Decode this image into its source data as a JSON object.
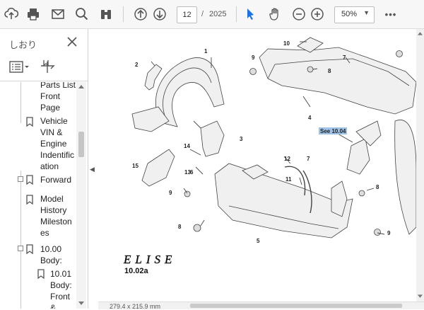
{
  "toolbar": {
    "tools": [
      "upload-icon",
      "print-icon",
      "mail-icon",
      "search-icon",
      "binoculars-icon",
      "page-up-icon",
      "page-down-icon",
      "select-cursor-icon",
      "hand-icon",
      "zoom-out-icon",
      "zoom-in-icon",
      "more-icon"
    ],
    "page_current": "12",
    "page_separator": "/",
    "page_total": "2025",
    "zoom": "50%",
    "zoom_caret": "▼",
    "more": "•••"
  },
  "sidebar": {
    "title": "しおり",
    "close": "✕",
    "bookmarks": [
      {
        "label": "Parts List Front Page",
        "level": 1
      },
      {
        "label": "Vehicle VIN & Engine Indentification",
        "level": 1
      },
      {
        "label": "Forward",
        "level": 1
      },
      {
        "label": "Model History Milestones",
        "level": 1
      },
      {
        "label": "10.00 Body:",
        "level": 1
      },
      {
        "label": "10.01 Body: Front &",
        "level": 2
      }
    ],
    "bookmark_lines": [
      [
        "Parts List",
        "Front",
        "Page"
      ],
      [
        "Vehicle",
        "VIN &",
        "Engine",
        "Indentific",
        "ation"
      ],
      [
        "Forward"
      ],
      [
        "Model",
        "History",
        "Mileston",
        "es"
      ],
      [
        "10.00",
        "Body:"
      ],
      [
        "10.01",
        "Body:",
        "Front",
        "&"
      ]
    ]
  },
  "document": {
    "page_size": "279.4 x 215.9 mm",
    "logo": "ELISE",
    "figure_code": "10.02a",
    "highlight_text": "See 10.04",
    "callouts": [
      "1",
      "2",
      "3",
      "4",
      "5",
      "6",
      "7",
      "7",
      "8",
      "8",
      "8",
      "9",
      "9",
      "9",
      "10",
      "11",
      "12",
      "13",
      "14",
      "15"
    ]
  },
  "colors": {
    "toolbar_bg": "#f7f7f7",
    "accent": "#1a73e8",
    "highlight": "#9fc3e6"
  }
}
